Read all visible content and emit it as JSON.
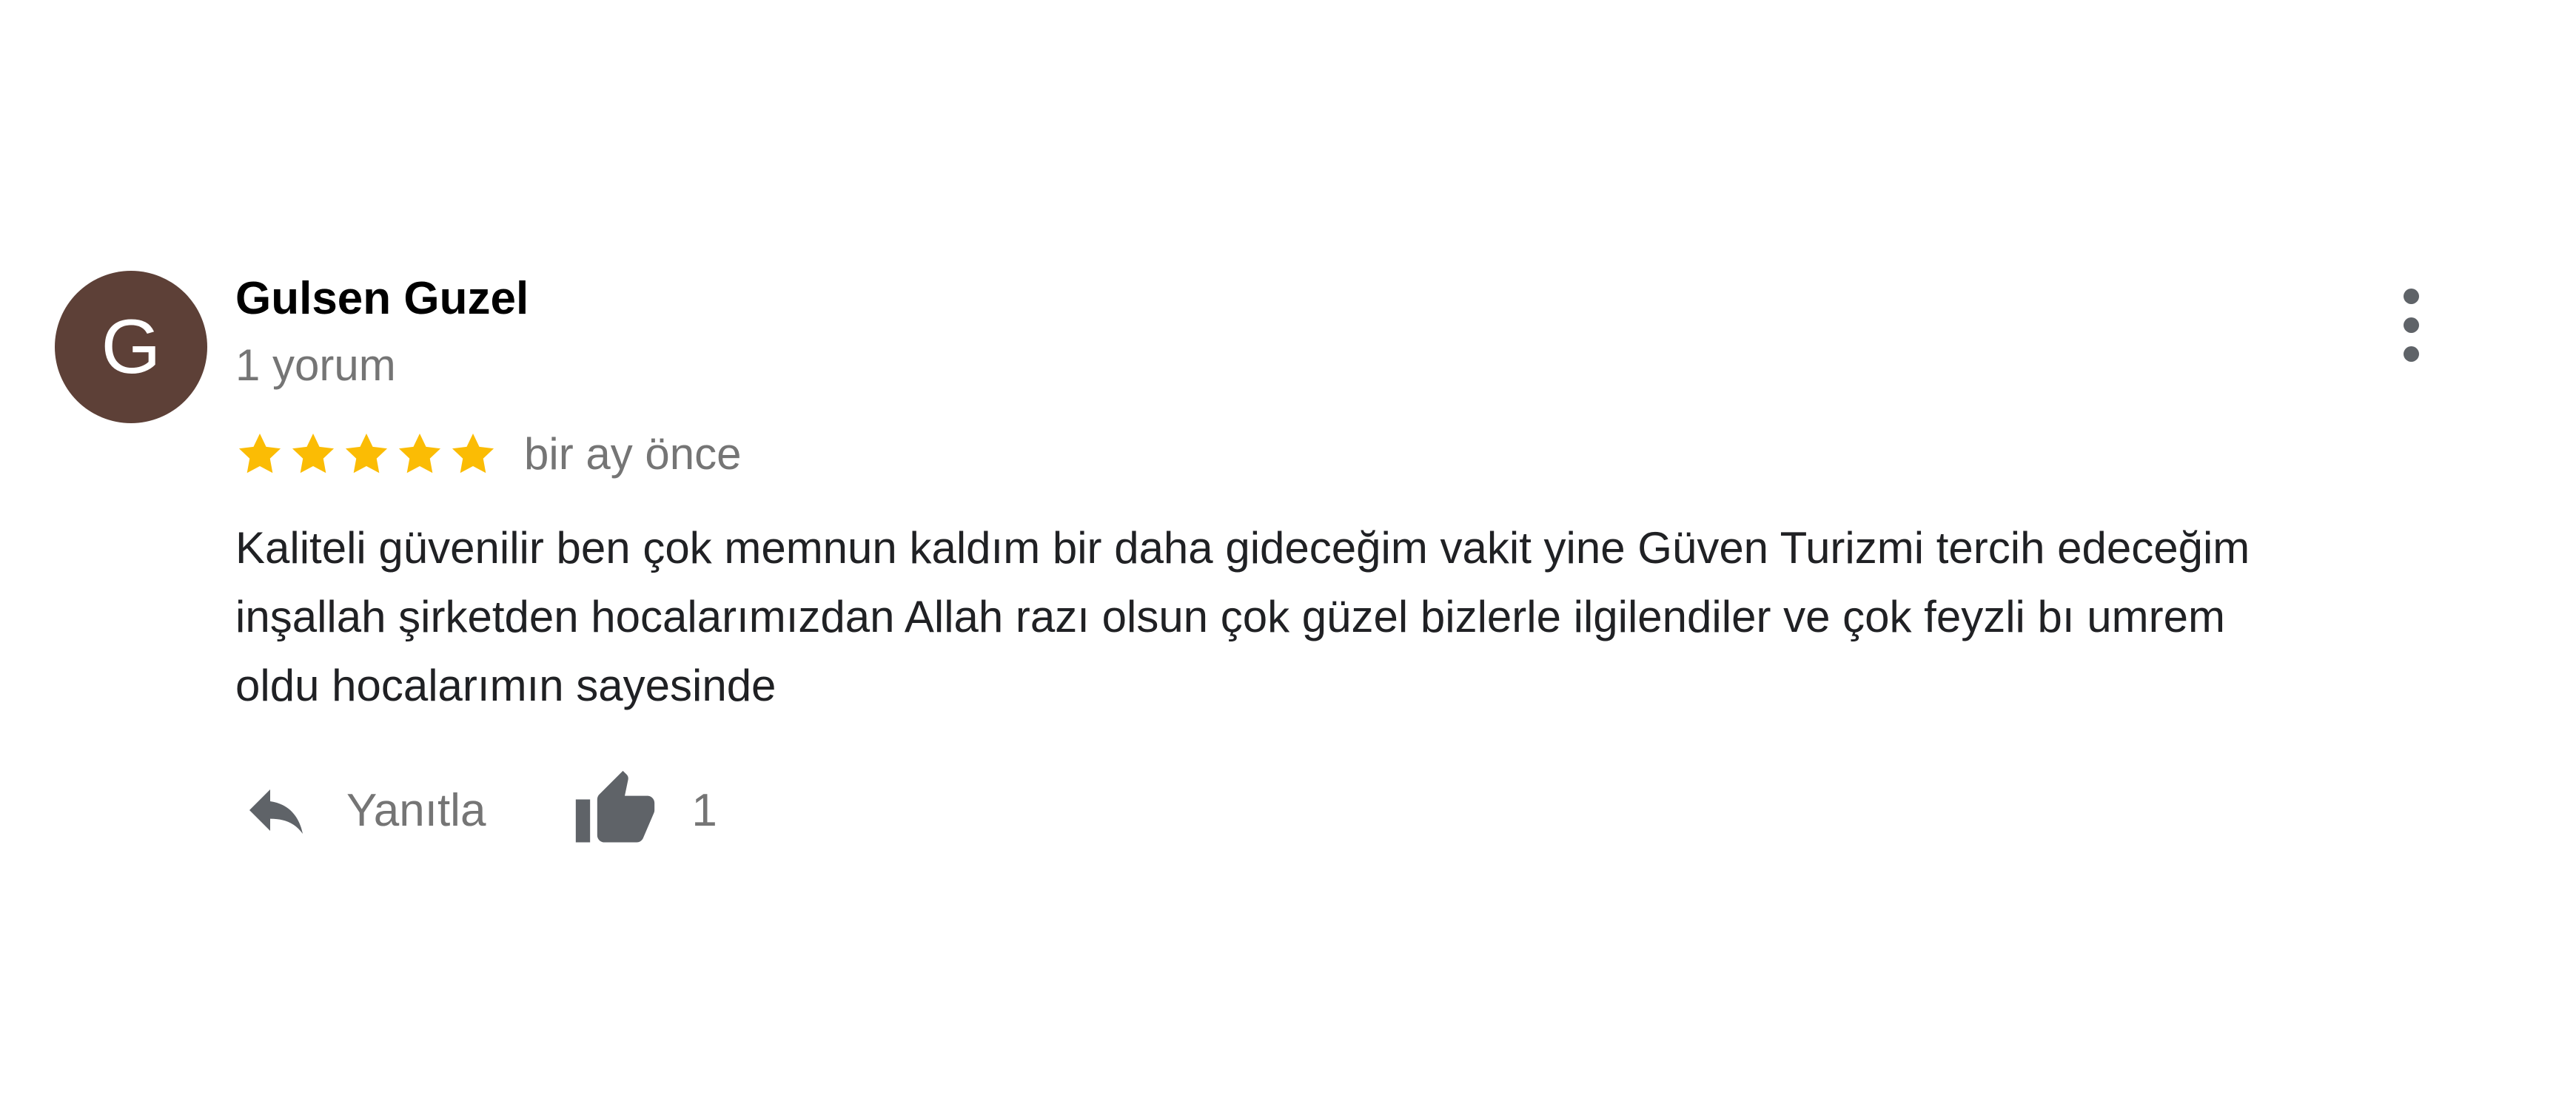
{
  "reviewer": {
    "avatar_letter": "G",
    "avatar_color": "#5d4037",
    "name": "Gulsen Guzel",
    "review_count": "1 yorum"
  },
  "review": {
    "rating": 5,
    "max_rating": 5,
    "star_color": "#fbbc04",
    "date": "bir ay önce",
    "text_lines": [
      "Kaliteli güvenilir ben çok memnun kaldım bir daha gideceğim vakit yine Güven Turizmi tercih edeceğim",
      "inşallah şirketden hocalarımızdan Allah razı olsun çok güzel bizlerle ilgilendiler ve çok feyzli bı umrem",
      "oldu hocalarımın sayesinde"
    ]
  },
  "actions": {
    "reply_icon": "reply-icon",
    "reply_label": "Yanıtla",
    "like_icon": "thumbs-up-icon",
    "like_count": "1",
    "more_icon": "more-vertical-icon"
  },
  "colors": {
    "icon_gray": "#5f6368",
    "secondary_text": "#757575",
    "body_text": "#202124"
  }
}
